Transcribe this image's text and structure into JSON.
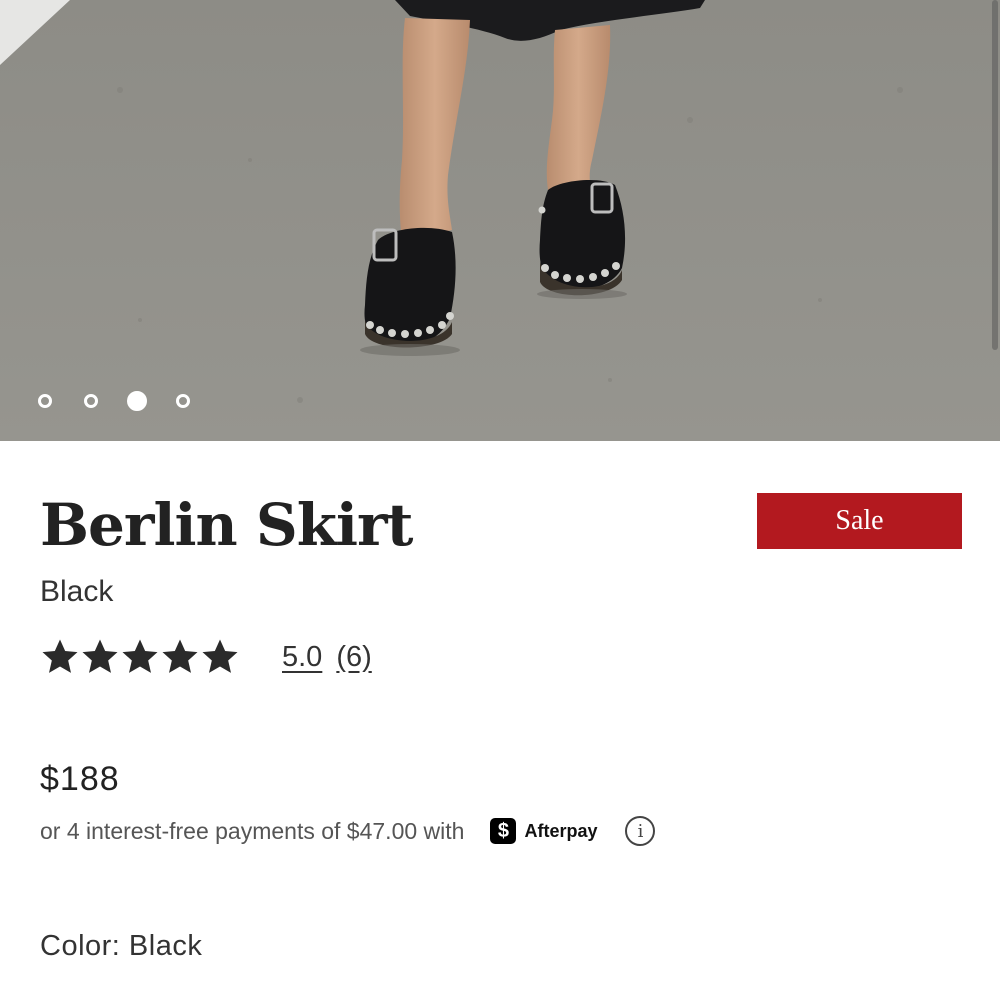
{
  "gallery": {
    "slide_count": 4,
    "active_index": 2,
    "image_icon": "product-photo-clogs"
  },
  "product": {
    "title": "Berlin Skirt",
    "variant": "Black",
    "badge": "Sale",
    "badge_color": "#b3191f"
  },
  "rating": {
    "stars": 5,
    "max_stars": 5,
    "score": "5.0",
    "count": "(6)"
  },
  "pricing": {
    "price": "$188",
    "installment_text": "or 4 interest-free payments of $47.00 with",
    "provider_logo_glyph": "$",
    "provider_name": "Afterpay",
    "info_glyph": "i"
  },
  "color": {
    "label": "Color: Black"
  }
}
